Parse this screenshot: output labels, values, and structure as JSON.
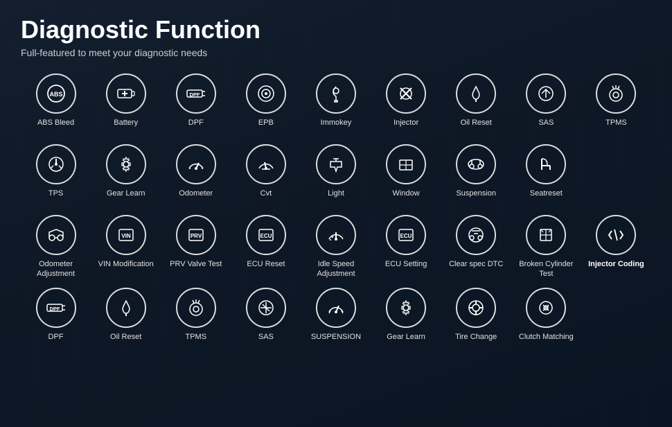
{
  "header": {
    "title": "Diagnostic Function",
    "subtitle": "Full-featured to meet your diagnostic needs"
  },
  "items": [
    {
      "id": "abs-bleed",
      "label": "ABS Bleed",
      "icon": "abs"
    },
    {
      "id": "battery",
      "label": "Battery",
      "icon": "battery"
    },
    {
      "id": "dpf",
      "label": "DPF",
      "icon": "dpf"
    },
    {
      "id": "epb",
      "label": "EPB",
      "icon": "epb"
    },
    {
      "id": "immokey",
      "label": "Immokey",
      "icon": "immokey"
    },
    {
      "id": "injector",
      "label": "Injector",
      "icon": "injector"
    },
    {
      "id": "oil-reset",
      "label": "Oil Reset",
      "icon": "oil"
    },
    {
      "id": "sas",
      "label": "SAS",
      "icon": "sas"
    },
    {
      "id": "tpms",
      "label": "TPMS",
      "icon": "tpms"
    },
    {
      "id": "tps",
      "label": "TPS",
      "icon": "tps"
    },
    {
      "id": "gear-learn",
      "label": "Gear Learn",
      "icon": "gear"
    },
    {
      "id": "odometer",
      "label": "Odometer",
      "icon": "odometer"
    },
    {
      "id": "cvt",
      "label": "Cvt",
      "icon": "cvt"
    },
    {
      "id": "light",
      "label": "Light",
      "icon": "light"
    },
    {
      "id": "window",
      "label": "Window",
      "icon": "window"
    },
    {
      "id": "suspension",
      "label": "Suspension",
      "icon": "suspension"
    },
    {
      "id": "seatreset",
      "label": "Seatreset",
      "icon": "seat"
    },
    {
      "id": "row2-empty",
      "label": "",
      "icon": "empty"
    },
    {
      "id": "odometer-adj",
      "label": "Odometer\nAdjustment",
      "icon": "odometer2"
    },
    {
      "id": "vin",
      "label": "VIN\nModification",
      "icon": "vin"
    },
    {
      "id": "prv",
      "label": "PRV\nValve Test",
      "icon": "prv"
    },
    {
      "id": "ecu-reset",
      "label": "ECU Reset",
      "icon": "ecu"
    },
    {
      "id": "idle-speed",
      "label": "Idle Speed\nAdjustment",
      "icon": "idle"
    },
    {
      "id": "ecu-setting",
      "label": "ECU Setting",
      "icon": "ecuS"
    },
    {
      "id": "clear-spec",
      "label": "Clear\nspec DTC",
      "icon": "clearspec"
    },
    {
      "id": "broken-cyl",
      "label": "Broken\nCylinder Test",
      "icon": "broken"
    },
    {
      "id": "injector-coding",
      "label": "Injector\nCoding",
      "icon": "injcode",
      "bold": true
    },
    {
      "id": "dpf2",
      "label": "DPF",
      "icon": "dpf"
    },
    {
      "id": "oil-reset2",
      "label": "Oil Reset",
      "icon": "oil"
    },
    {
      "id": "tpms2",
      "label": "TPMS",
      "icon": "tpms"
    },
    {
      "id": "sas2",
      "label": "SAS",
      "icon": "sas"
    },
    {
      "id": "suspension2",
      "label": "SUSPENSION",
      "icon": "suspension2"
    },
    {
      "id": "gear-learn2",
      "label": "Gear Learn",
      "icon": "gear2"
    },
    {
      "id": "tire-change",
      "label": "Tire Change",
      "icon": "tire"
    },
    {
      "id": "clutch",
      "label": "Clutch Matching",
      "icon": "clutch"
    },
    {
      "id": "row3-empty",
      "label": "",
      "icon": "empty"
    }
  ]
}
